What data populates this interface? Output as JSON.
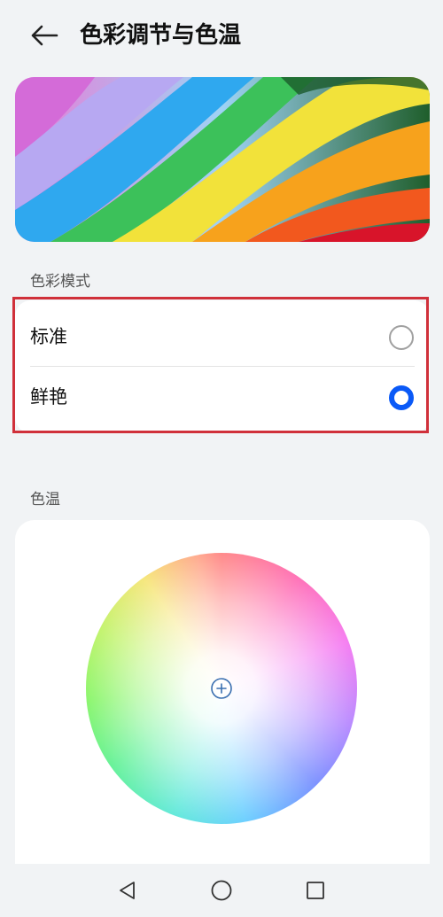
{
  "header": {
    "title": "色彩调节与色温",
    "back_icon": "arrow-left-icon"
  },
  "color_mode": {
    "section_label": "色彩模式",
    "options": [
      {
        "label": "标准",
        "selected": false
      },
      {
        "label": "鲜艳",
        "selected": true
      }
    ],
    "accent_color": "#0a59f7",
    "highlight_color": "#d0303a"
  },
  "color_temperature": {
    "section_label": "色温",
    "handle_icon": "plus-circle-icon"
  },
  "nav_bar": {
    "icons": [
      "triangle-back-icon",
      "circle-home-icon",
      "square-recents-icon"
    ]
  }
}
